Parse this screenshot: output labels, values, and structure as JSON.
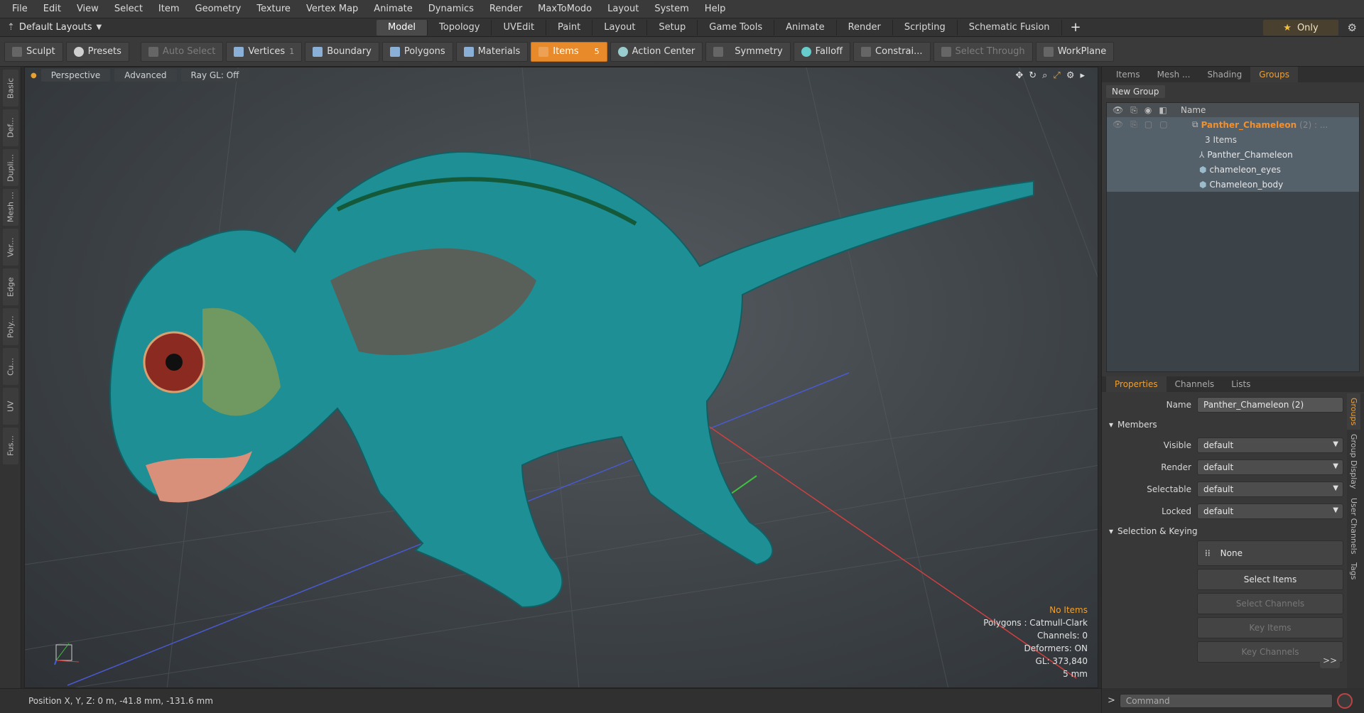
{
  "menu": [
    "File",
    "Edit",
    "View",
    "Select",
    "Item",
    "Geometry",
    "Texture",
    "Vertex Map",
    "Animate",
    "Dynamics",
    "Render",
    "MaxToModo",
    "Layout",
    "System",
    "Help"
  ],
  "layouts": {
    "label": "Default Layouts"
  },
  "tabs": [
    {
      "label": "Model",
      "active": true
    },
    {
      "label": "Topology"
    },
    {
      "label": "UVEdit"
    },
    {
      "label": "Paint"
    },
    {
      "label": "Layout"
    },
    {
      "label": "Setup"
    },
    {
      "label": "Game Tools"
    },
    {
      "label": "Animate"
    },
    {
      "label": "Render"
    },
    {
      "label": "Scripting"
    },
    {
      "label": "Schematic Fusion"
    }
  ],
  "only": {
    "label": "Only"
  },
  "toolbar": {
    "sculpt": "Sculpt",
    "presets": "Presets",
    "auto_select": "Auto Select",
    "vertices": "Vertices",
    "vertices_count": "1",
    "boundary": "Boundary",
    "polygons": "Polygons",
    "materials": "Materials",
    "items": "Items",
    "items_count": "5",
    "action_center": "Action Center",
    "symmetry": "Symmetry",
    "falloff": "Falloff",
    "constrain": "Constrai...",
    "select_through": "Select Through",
    "workplane": "WorkPlane"
  },
  "left_tabs": [
    "Basic",
    "Def...",
    "Dupli...",
    "Mesh ...",
    "Ver...",
    "Edge",
    "Poly...",
    "Cu...",
    "UV",
    "Fus..."
  ],
  "viewport": {
    "perspective": "Perspective",
    "advanced": "Advanced",
    "raygl": "Ray GL: Off",
    "hud": {
      "selection": "No Items",
      "polygons": "Polygons : Catmull-Clark",
      "channels": "Channels: 0",
      "deformers": "Deformers: ON",
      "gl": "GL: 373,840",
      "scale": "5 mm"
    }
  },
  "status": {
    "position": "Position X, Y, Z:  0 m, -41.8 mm, -131.6 mm"
  },
  "right_tabs": [
    "Items",
    "Mesh ...",
    "Shading",
    "Groups"
  ],
  "groups": {
    "new_group": "New Group",
    "col_name": "Name",
    "group_name": "Panther_Chameleon",
    "group_suffix": "(2) : ...",
    "item_count": "3 Items",
    "items": [
      "Panther_Chameleon",
      "chameleon_eyes",
      "Chameleon_body"
    ]
  },
  "props_tabs": [
    "Properties",
    "Channels",
    "Lists"
  ],
  "properties": {
    "name_label": "Name",
    "name_value": "Panther_Chameleon (2)",
    "members": "Members",
    "rows": [
      {
        "label": "Visible",
        "value": "default"
      },
      {
        "label": "Render",
        "value": "default"
      },
      {
        "label": "Selectable",
        "value": "default"
      },
      {
        "label": "Locked",
        "value": "default"
      }
    ],
    "selection_keying": "Selection & Keying",
    "none": "None",
    "select_items": "Select Items",
    "select_channels": "Select Channels",
    "key_items": "Key Items",
    "key_channels": "Key Channels",
    "more": ">>"
  },
  "side_vertical": [
    "Groups",
    "Group Display",
    "User Channels",
    "Tags"
  ],
  "command": {
    "placeholder": "Command"
  }
}
